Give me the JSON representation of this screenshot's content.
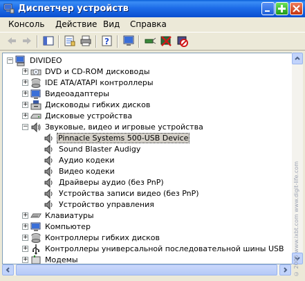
{
  "window": {
    "title": "Диспетчер устройств"
  },
  "menu": [
    "Консоль",
    "Действие",
    "Вид",
    "Справка"
  ],
  "tree": {
    "root": "DIVIDEO",
    "items": [
      {
        "label": "DVD и CD-ROM дисководы",
        "expander": "+",
        "icon": "cdrom-icon"
      },
      {
        "label": "IDE ATA/ATAPI контроллеры",
        "expander": "+",
        "icon": "ide-controller-icon"
      },
      {
        "label": "Видеоадаптеры",
        "expander": "+",
        "icon": "display-adapter-icon"
      },
      {
        "label": "Дисководы гибких дисков",
        "expander": "+",
        "icon": "floppy-drive-icon"
      },
      {
        "label": "Дисковые устройства",
        "expander": "+",
        "icon": "disk-drive-icon"
      },
      {
        "label": "Звуковые, видео и игровые устройства",
        "expander": "−",
        "icon": "sound-device-icon",
        "children": [
          {
            "label": "Pinnacle Systems 500-USB Device",
            "selected": true
          },
          {
            "label": "Sound Blaster Audigy"
          },
          {
            "label": "Аудио кодеки"
          },
          {
            "label": "Видео кодеки"
          },
          {
            "label": "Драйверы аудио (без PnP)"
          },
          {
            "label": "Устройства записи видео (без PnP)"
          },
          {
            "label": "Устройство управления"
          }
        ]
      },
      {
        "label": "Клавиатуры",
        "expander": "+",
        "icon": "keyboard-icon"
      },
      {
        "label": "Компьютер",
        "expander": "+",
        "icon": "computer-icon"
      },
      {
        "label": "Контроллеры гибких дисков",
        "expander": "+",
        "icon": "floppy-controller-icon"
      },
      {
        "label": "Контроллеры универсальной последовательной шины USB",
        "expander": "+",
        "icon": "usb-icon"
      },
      {
        "label": "Модемы",
        "expander": "+",
        "icon": "modem-icon"
      }
    ]
  },
  "watermark": "© 2005 www.ixbt.com  www.digit-life.com"
}
